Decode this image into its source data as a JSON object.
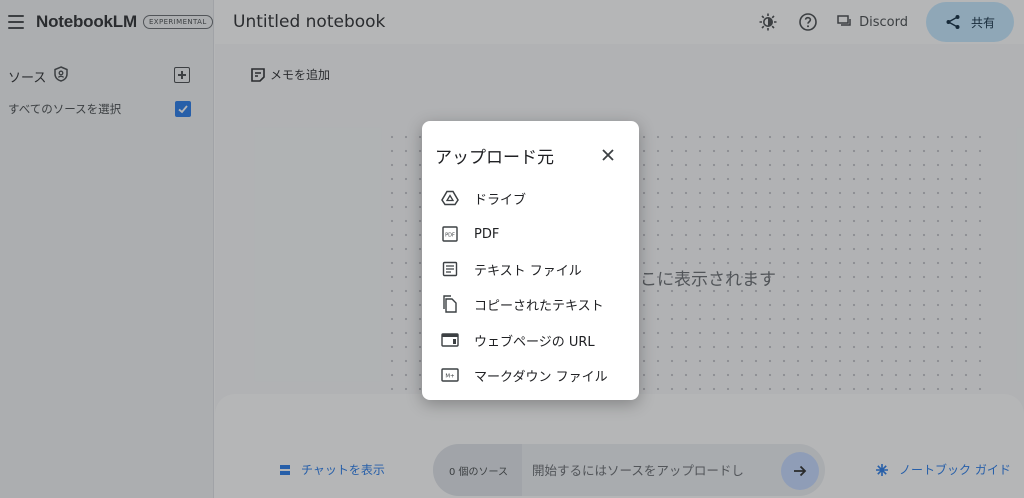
{
  "app": {
    "brand": "NotebookLM",
    "badge": "EXPERIMENTAL",
    "notebook_title": "Untitled notebook"
  },
  "header": {
    "discord_label": "Discord",
    "share_label": "共有"
  },
  "sidebar": {
    "sources_label": "ソース",
    "select_all_label": "すべてのソースを選択",
    "select_all_checked": true
  },
  "main": {
    "add_note_label": "メモを追加",
    "empty_state_partial": "ここに表示されます"
  },
  "chat": {
    "toggle_label": "チャットを表示",
    "source_count": "0 個のソース",
    "input_placeholder": "開始するにはソースをアップロードし",
    "guide_label": "ノートブック ガイド"
  },
  "modal": {
    "title": "アップロード元",
    "options": [
      {
        "label": "ドライブ",
        "icon": "drive-icon"
      },
      {
        "label": "PDF",
        "icon": "pdf-icon"
      },
      {
        "label": "テキスト ファイル",
        "icon": "text-file-icon"
      },
      {
        "label": "コピーされたテキスト",
        "icon": "copy-icon"
      },
      {
        "label": "ウェブページの URL",
        "icon": "web-icon"
      },
      {
        "label": "マークダウン ファイル",
        "icon": "markdown-icon"
      }
    ]
  },
  "colors": {
    "accent": "#1a73e8",
    "share_bg": "#c2e7ff"
  }
}
